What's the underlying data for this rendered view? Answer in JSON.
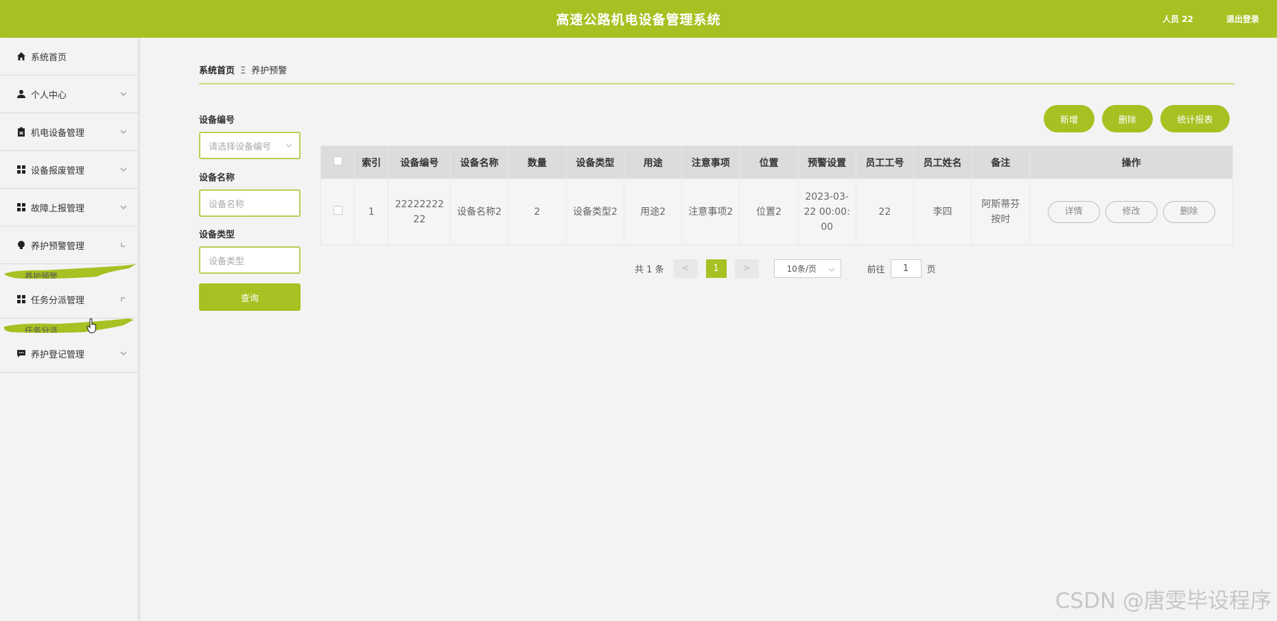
{
  "header": {
    "title": "高速公路机电设备管理系统",
    "user": "人员 22",
    "logout": "退出登录"
  },
  "sidebar": {
    "items": [
      {
        "label": "系统首页",
        "icon": "home-icon"
      },
      {
        "label": "个人中心",
        "icon": "user-icon"
      },
      {
        "label": "机电设备管理",
        "icon": "clipboard-icon"
      },
      {
        "label": "设备报废管理",
        "icon": "grid-icon"
      },
      {
        "label": "故障上报管理",
        "icon": "grid-icon"
      },
      {
        "label": "养护预警管理",
        "icon": "bulb-icon"
      },
      {
        "label": "任务分派管理",
        "icon": "grid-icon"
      },
      {
        "label": "养护登记管理",
        "icon": "chat-icon"
      }
    ],
    "sub1": "养护预警",
    "sub2": "任务分派"
  },
  "breadcrumb": {
    "home": "系统首页",
    "separator": "Ξ",
    "current": "养护预警"
  },
  "search": {
    "field1_label": "设备编号",
    "field1_placeholder": "请选择设备编号",
    "field2_label": "设备名称",
    "field2_placeholder": "设备名称",
    "field3_label": "设备类型",
    "field3_placeholder": "设备类型",
    "button": "查询"
  },
  "toolbar": {
    "add": "新增",
    "delete": "删除",
    "report": "统计报表"
  },
  "table": {
    "headers": [
      "索引",
      "设备编号",
      "设备名称",
      "数量",
      "设备类型",
      "用途",
      "注意事项",
      "位置",
      "预警设置",
      "员工工号",
      "员工姓名",
      "备注",
      "操作"
    ],
    "rows": [
      {
        "index": "1",
        "code_line1": "22222222",
        "code_line2": "22",
        "name": "设备名称2",
        "qty": "2",
        "type": "设备类型2",
        "usage": "用途2",
        "notes": "注意事项2",
        "location": "位置2",
        "alert_l1": "2023-03-",
        "alert_l2": "22 00:00:",
        "alert_l3": "00",
        "emp_no": "22",
        "emp_name": "李四",
        "remark_l1": "阿斯蒂芬",
        "remark_l2": "按时",
        "op_detail": "详情",
        "op_edit": "修改",
        "op_delete": "删除"
      }
    ]
  },
  "pagination": {
    "total": "共 1 条",
    "prev": "<",
    "current": "1",
    "next": ">",
    "page_size": "10条/页",
    "goto_label": "前往",
    "goto_value": "1",
    "page_unit": "页"
  },
  "watermark": "CSDN @唐雯毕设程序",
  "colors": {
    "accent": "#a6c122"
  }
}
